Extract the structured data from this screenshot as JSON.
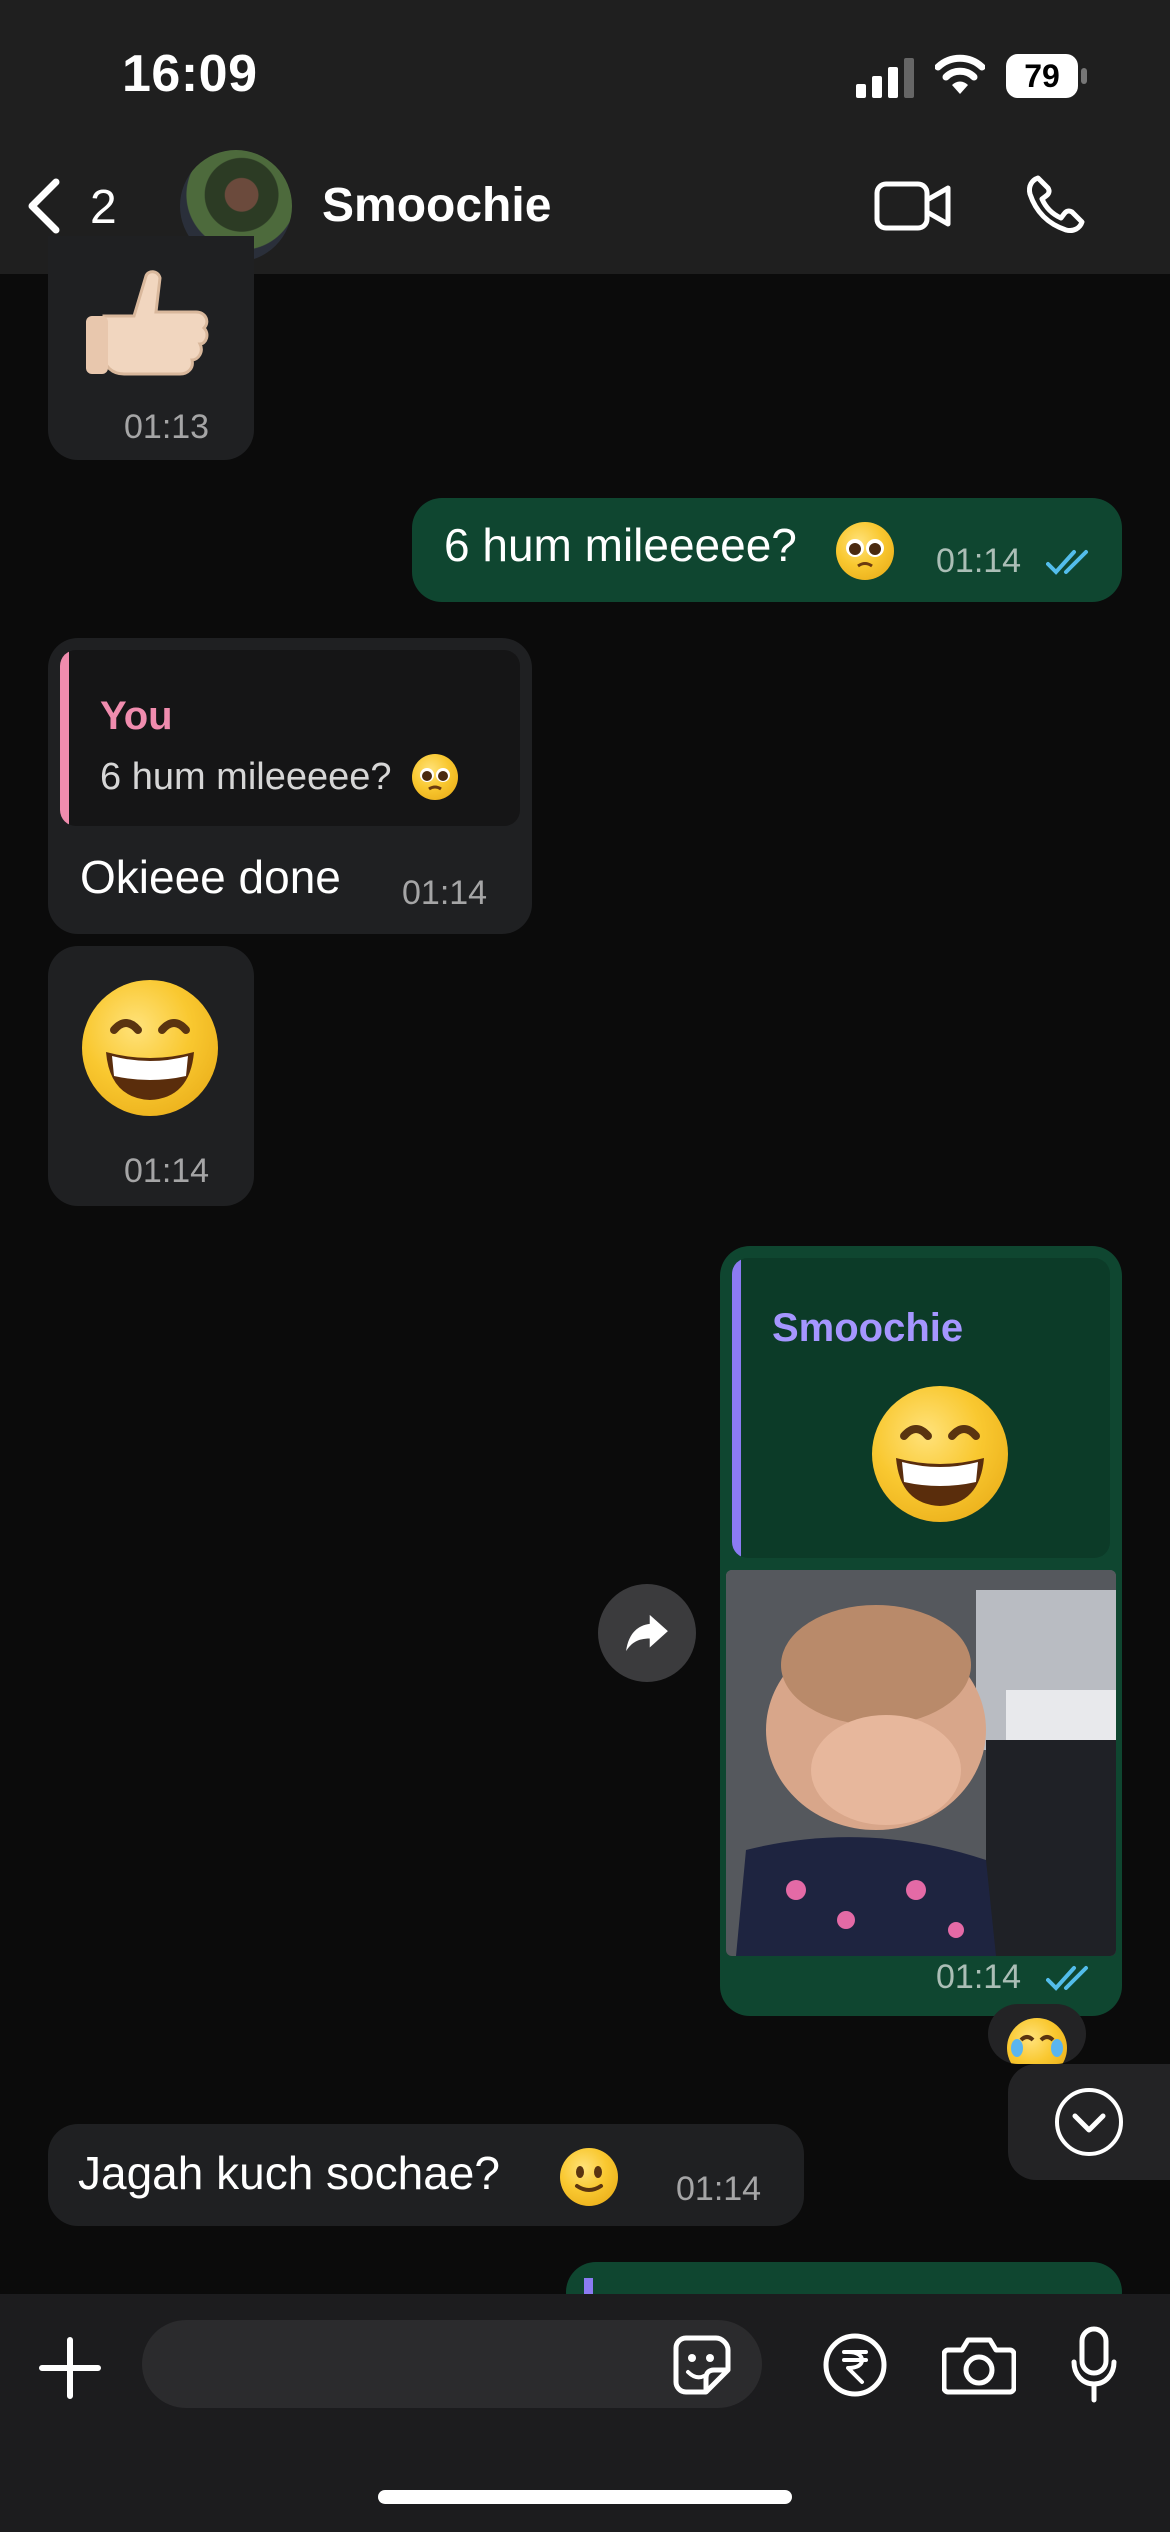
{
  "status_bar": {
    "time": "16:09",
    "battery": "79"
  },
  "header": {
    "back_count": "2",
    "contact_name": "Smoochie"
  },
  "messages": {
    "m1": {
      "time": "01:13",
      "icon": "thumbs-up-emoji"
    },
    "m2": {
      "text": "6 hum mileeeee?",
      "time": "01:14",
      "icon": "pleading-face-emoji"
    },
    "m3": {
      "quote_author": "You",
      "quote_text": "6 hum mileeeee?",
      "text": "Okieee done",
      "time": "01:14"
    },
    "m4": {
      "time": "01:14",
      "icon": "grinning-face-emoji"
    },
    "m5": {
      "quote_author": "Smoochie",
      "time": "01:14",
      "media": "video-thumbnail-baby"
    },
    "m6": {
      "text": "Jagah kuch sochae?",
      "time": "01:14",
      "icon": "slightly-smiling-face-emoji"
    }
  },
  "reaction": {
    "icon": "tears-of-joy-emoji"
  },
  "composer": {
    "placeholder": ""
  },
  "colors": {
    "outgoing_bubble": "#0f4630",
    "incoming_bubble": "#1f2022",
    "read_ticks": "#53bdeb",
    "quote_you": "#f08cae",
    "quote_smoochie": "#8b7bf2"
  }
}
